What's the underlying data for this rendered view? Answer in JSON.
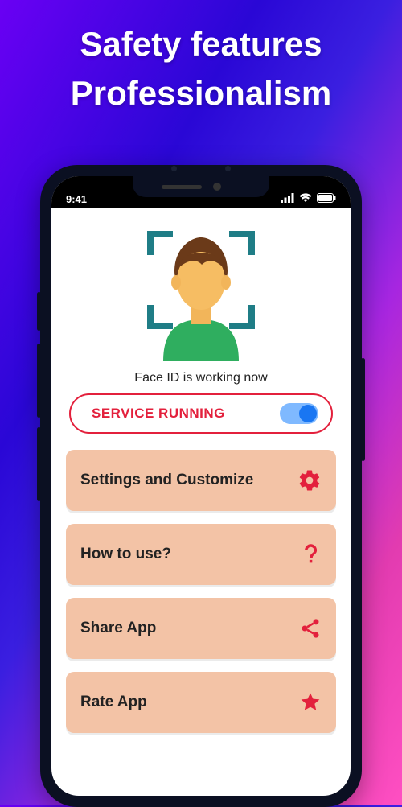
{
  "hero": {
    "line1": "Safety features",
    "line2": "Professionalism"
  },
  "statusbar": {
    "time": "9:41"
  },
  "face": {
    "status_text": "Face ID is working now"
  },
  "service": {
    "label": "Service Running",
    "on": true
  },
  "menu": {
    "items": [
      {
        "label": "Settings and Customize",
        "icon": "gear"
      },
      {
        "label": "How to use?",
        "icon": "question"
      },
      {
        "label": "Share App",
        "icon": "share"
      },
      {
        "label": "Rate App",
        "icon": "star"
      }
    ]
  }
}
